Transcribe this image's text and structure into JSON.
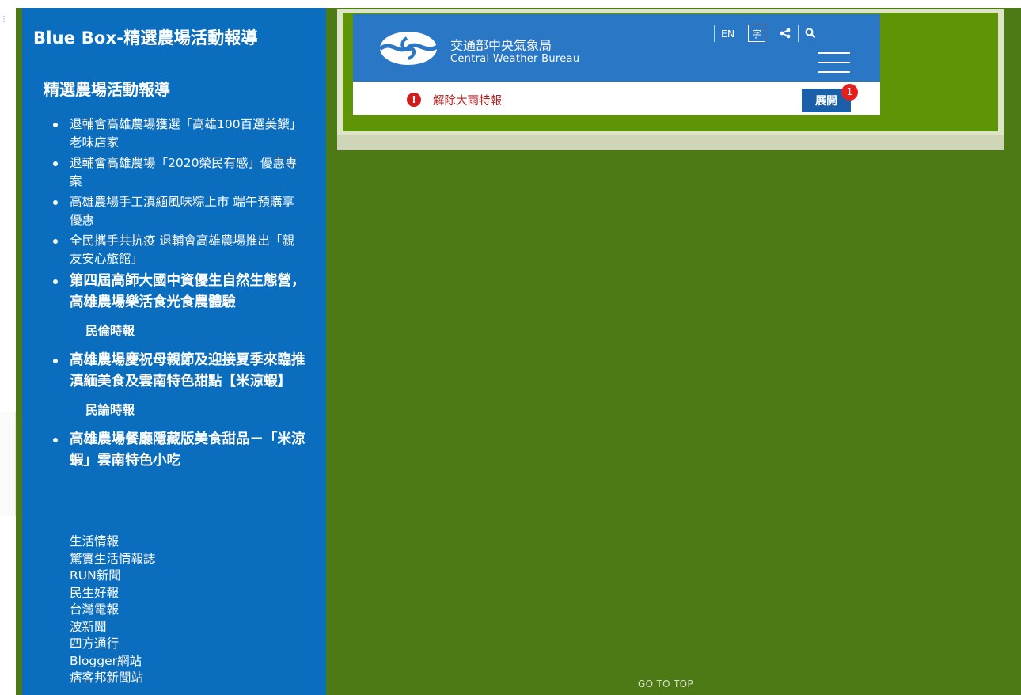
{
  "sidebar": {
    "site_title": "Blue Box-精選農場活動報導",
    "section_title": "精選農場活動報導",
    "articles": [
      {
        "title": "退輔會高雄農場獲選「高雄100百選美饌」老味店家",
        "source": ""
      },
      {
        "title": "退輔會高雄農場「2020榮民有感」優惠專案",
        "source": ""
      },
      {
        "title": "高雄農場手工滇緬風味粽上市 端午預購享優惠",
        "source": ""
      },
      {
        "title": "全民攜手共抗疫 退輔會高雄農場推出「親友安心旅館」",
        "source": ""
      },
      {
        "title": "第四屆高師大國中資優生自然生態營，高雄農場樂活食光食農體驗",
        "source": "民倫時報"
      },
      {
        "title": "高雄農場慶祝母親節及迎接夏季來臨推滇緬美食及雲南特色甜點【米涼蝦】",
        "source": "民論時報"
      },
      {
        "title": "高雄農場餐廳隱藏版美食甜品－「米涼蝦」雲南特色小吃",
        "source": ""
      }
    ],
    "links": [
      "生活情報",
      "驚實生活情報誌",
      "RUN新聞",
      "民生好報",
      "台灣電報",
      "波新聞",
      "四方通行",
      "Blogger網站",
      "痞客邦新聞站"
    ]
  },
  "cwb": {
    "name_zh": "交通部中央氣象局",
    "name_en": "Central Weather Bureau",
    "lang_label": "EN",
    "font_label": "字",
    "alert_text": "解除大雨特報",
    "expand_label": "展開",
    "badge_count": "1"
  },
  "footer": {
    "go_top": "GO TO TOP"
  },
  "colors": {
    "sidebar": "#0b6dbe",
    "page_bg": "#4e7a16",
    "cwb_blue": "#2a77c6",
    "alert_red": "#d21c1c"
  }
}
